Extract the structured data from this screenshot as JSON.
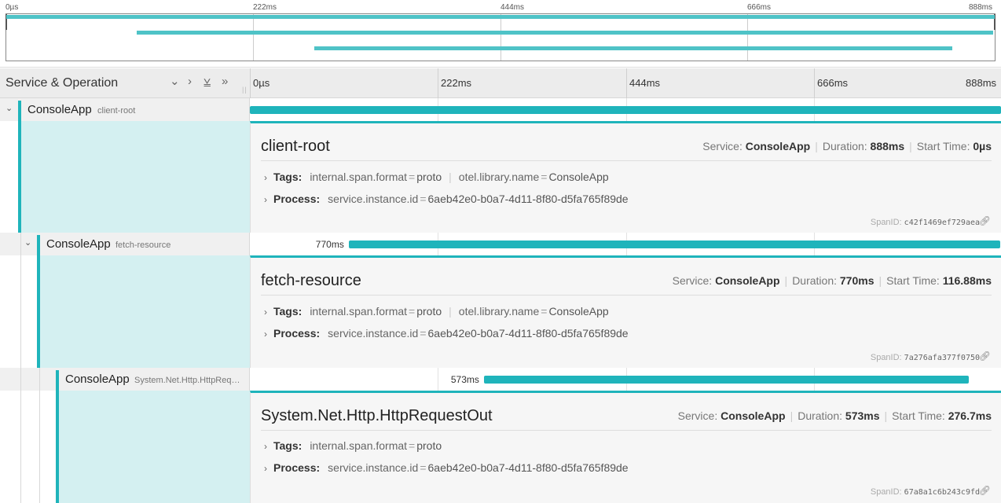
{
  "minimap": {
    "ticks": [
      "0µs",
      "222ms",
      "444ms",
      "666ms",
      "888ms"
    ]
  },
  "header": {
    "title": "Service & Operation",
    "buttons": [
      "collapse-one",
      "expand-one",
      "expand-all",
      "collapse-all"
    ],
    "ticks": [
      "0µs",
      "222ms",
      "444ms",
      "666ms",
      "888ms"
    ]
  },
  "colors": {
    "accent": "#1fb4bb",
    "accent_light": "#d4f0f1"
  },
  "spans": [
    {
      "service": "ConsoleApp",
      "operation": "client-root",
      "duration_label": "",
      "start_ms": 0,
      "duration_ms": 888,
      "detail": {
        "title": "client-root",
        "service_label": "Service:",
        "service": "ConsoleApp",
        "duration_label": "Duration:",
        "duration": "888ms",
        "start_label": "Start Time:",
        "start": "0µs",
        "tags_label": "Tags:",
        "tags": [
          {
            "key": "internal.span.format",
            "value": "proto"
          },
          {
            "key": "otel.library.name",
            "value": "ConsoleApp"
          }
        ],
        "process_label": "Process:",
        "process": [
          {
            "key": "service.instance.id",
            "value": "6aeb42e0-b0a7-4d11-8f80-d5fa765f89de"
          }
        ],
        "spanid_label": "SpanID:",
        "spanid": "c42f1469ef729aea"
      }
    },
    {
      "service": "ConsoleApp",
      "operation": "fetch-resource",
      "duration_label": "770ms",
      "start_ms": 116.88,
      "duration_ms": 770,
      "detail": {
        "title": "fetch-resource",
        "service_label": "Service:",
        "service": "ConsoleApp",
        "duration_label": "Duration:",
        "duration": "770ms",
        "start_label": "Start Time:",
        "start": "116.88ms",
        "tags_label": "Tags:",
        "tags": [
          {
            "key": "internal.span.format",
            "value": "proto"
          },
          {
            "key": "otel.library.name",
            "value": "ConsoleApp"
          }
        ],
        "process_label": "Process:",
        "process": [
          {
            "key": "service.instance.id",
            "value": "6aeb42e0-b0a7-4d11-8f80-d5fa765f89de"
          }
        ],
        "spanid_label": "SpanID:",
        "spanid": "7a276afa377f0750"
      }
    },
    {
      "service": "ConsoleApp",
      "operation": "System.Net.Http.HttpReq…",
      "duration_label": "573ms",
      "start_ms": 276.7,
      "duration_ms": 573,
      "detail": {
        "title": "System.Net.Http.HttpRequestOut",
        "service_label": "Service:",
        "service": "ConsoleApp",
        "duration_label": "Duration:",
        "duration": "573ms",
        "start_label": "Start Time:",
        "start": "276.7ms",
        "tags_label": "Tags:",
        "tags": [
          {
            "key": "internal.span.format",
            "value": "proto"
          }
        ],
        "process_label": "Process:",
        "process": [
          {
            "key": "service.instance.id",
            "value": "6aeb42e0-b0a7-4d11-8f80-d5fa765f89de"
          }
        ],
        "spanid_label": "SpanID:",
        "spanid": "67a8a1c6b243c9fd"
      }
    }
  ]
}
